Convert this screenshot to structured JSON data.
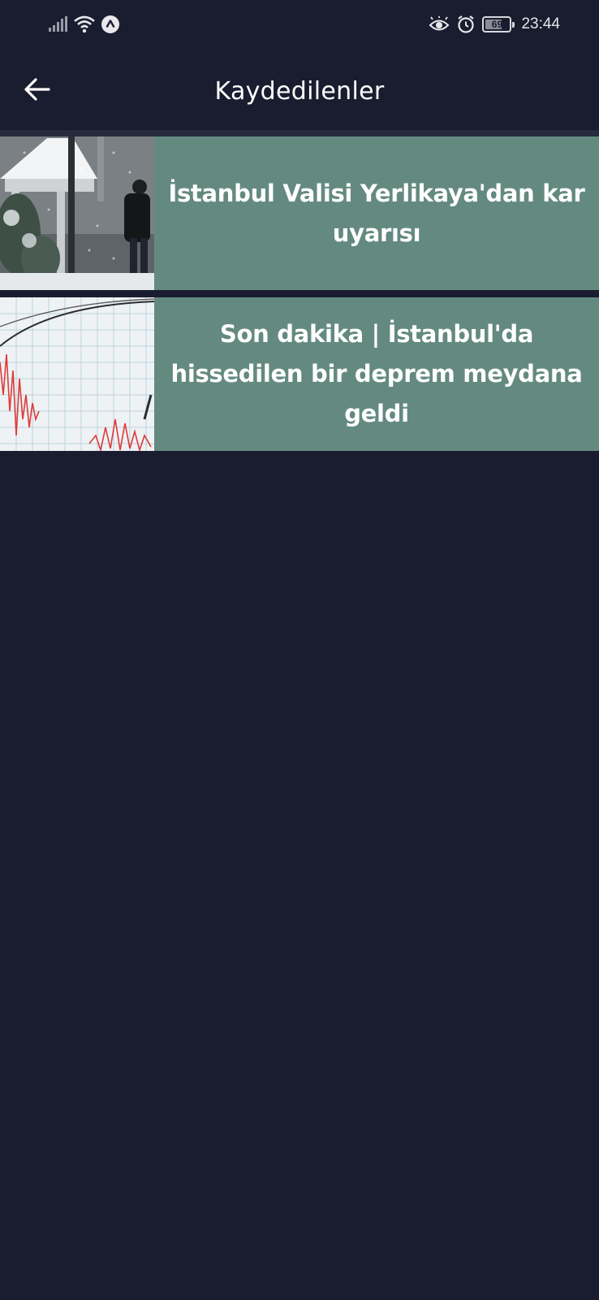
{
  "status_bar": {
    "time": "23:44",
    "battery_level": "69",
    "icons": [
      "signal-icon",
      "wifi-icon",
      "nfc-icon",
      "eye-icon",
      "alarm-icon",
      "battery-icon"
    ]
  },
  "app_bar": {
    "title": "Kaydedilenler",
    "back_icon": "arrow-left-icon"
  },
  "saved_items": [
    {
      "title": "İstanbul Valisi Yerlikaya'dan kar uyarısı",
      "thumbnail": "snowy-street-photo"
    },
    {
      "title": "Son dakika | İstanbul'da hissedilen bir deprem meydana geldi",
      "thumbnail": "seismograph-photo"
    }
  ],
  "colors": {
    "background": "#191d2f",
    "card_text_bg": "#648a80",
    "text": "#ffffff"
  }
}
